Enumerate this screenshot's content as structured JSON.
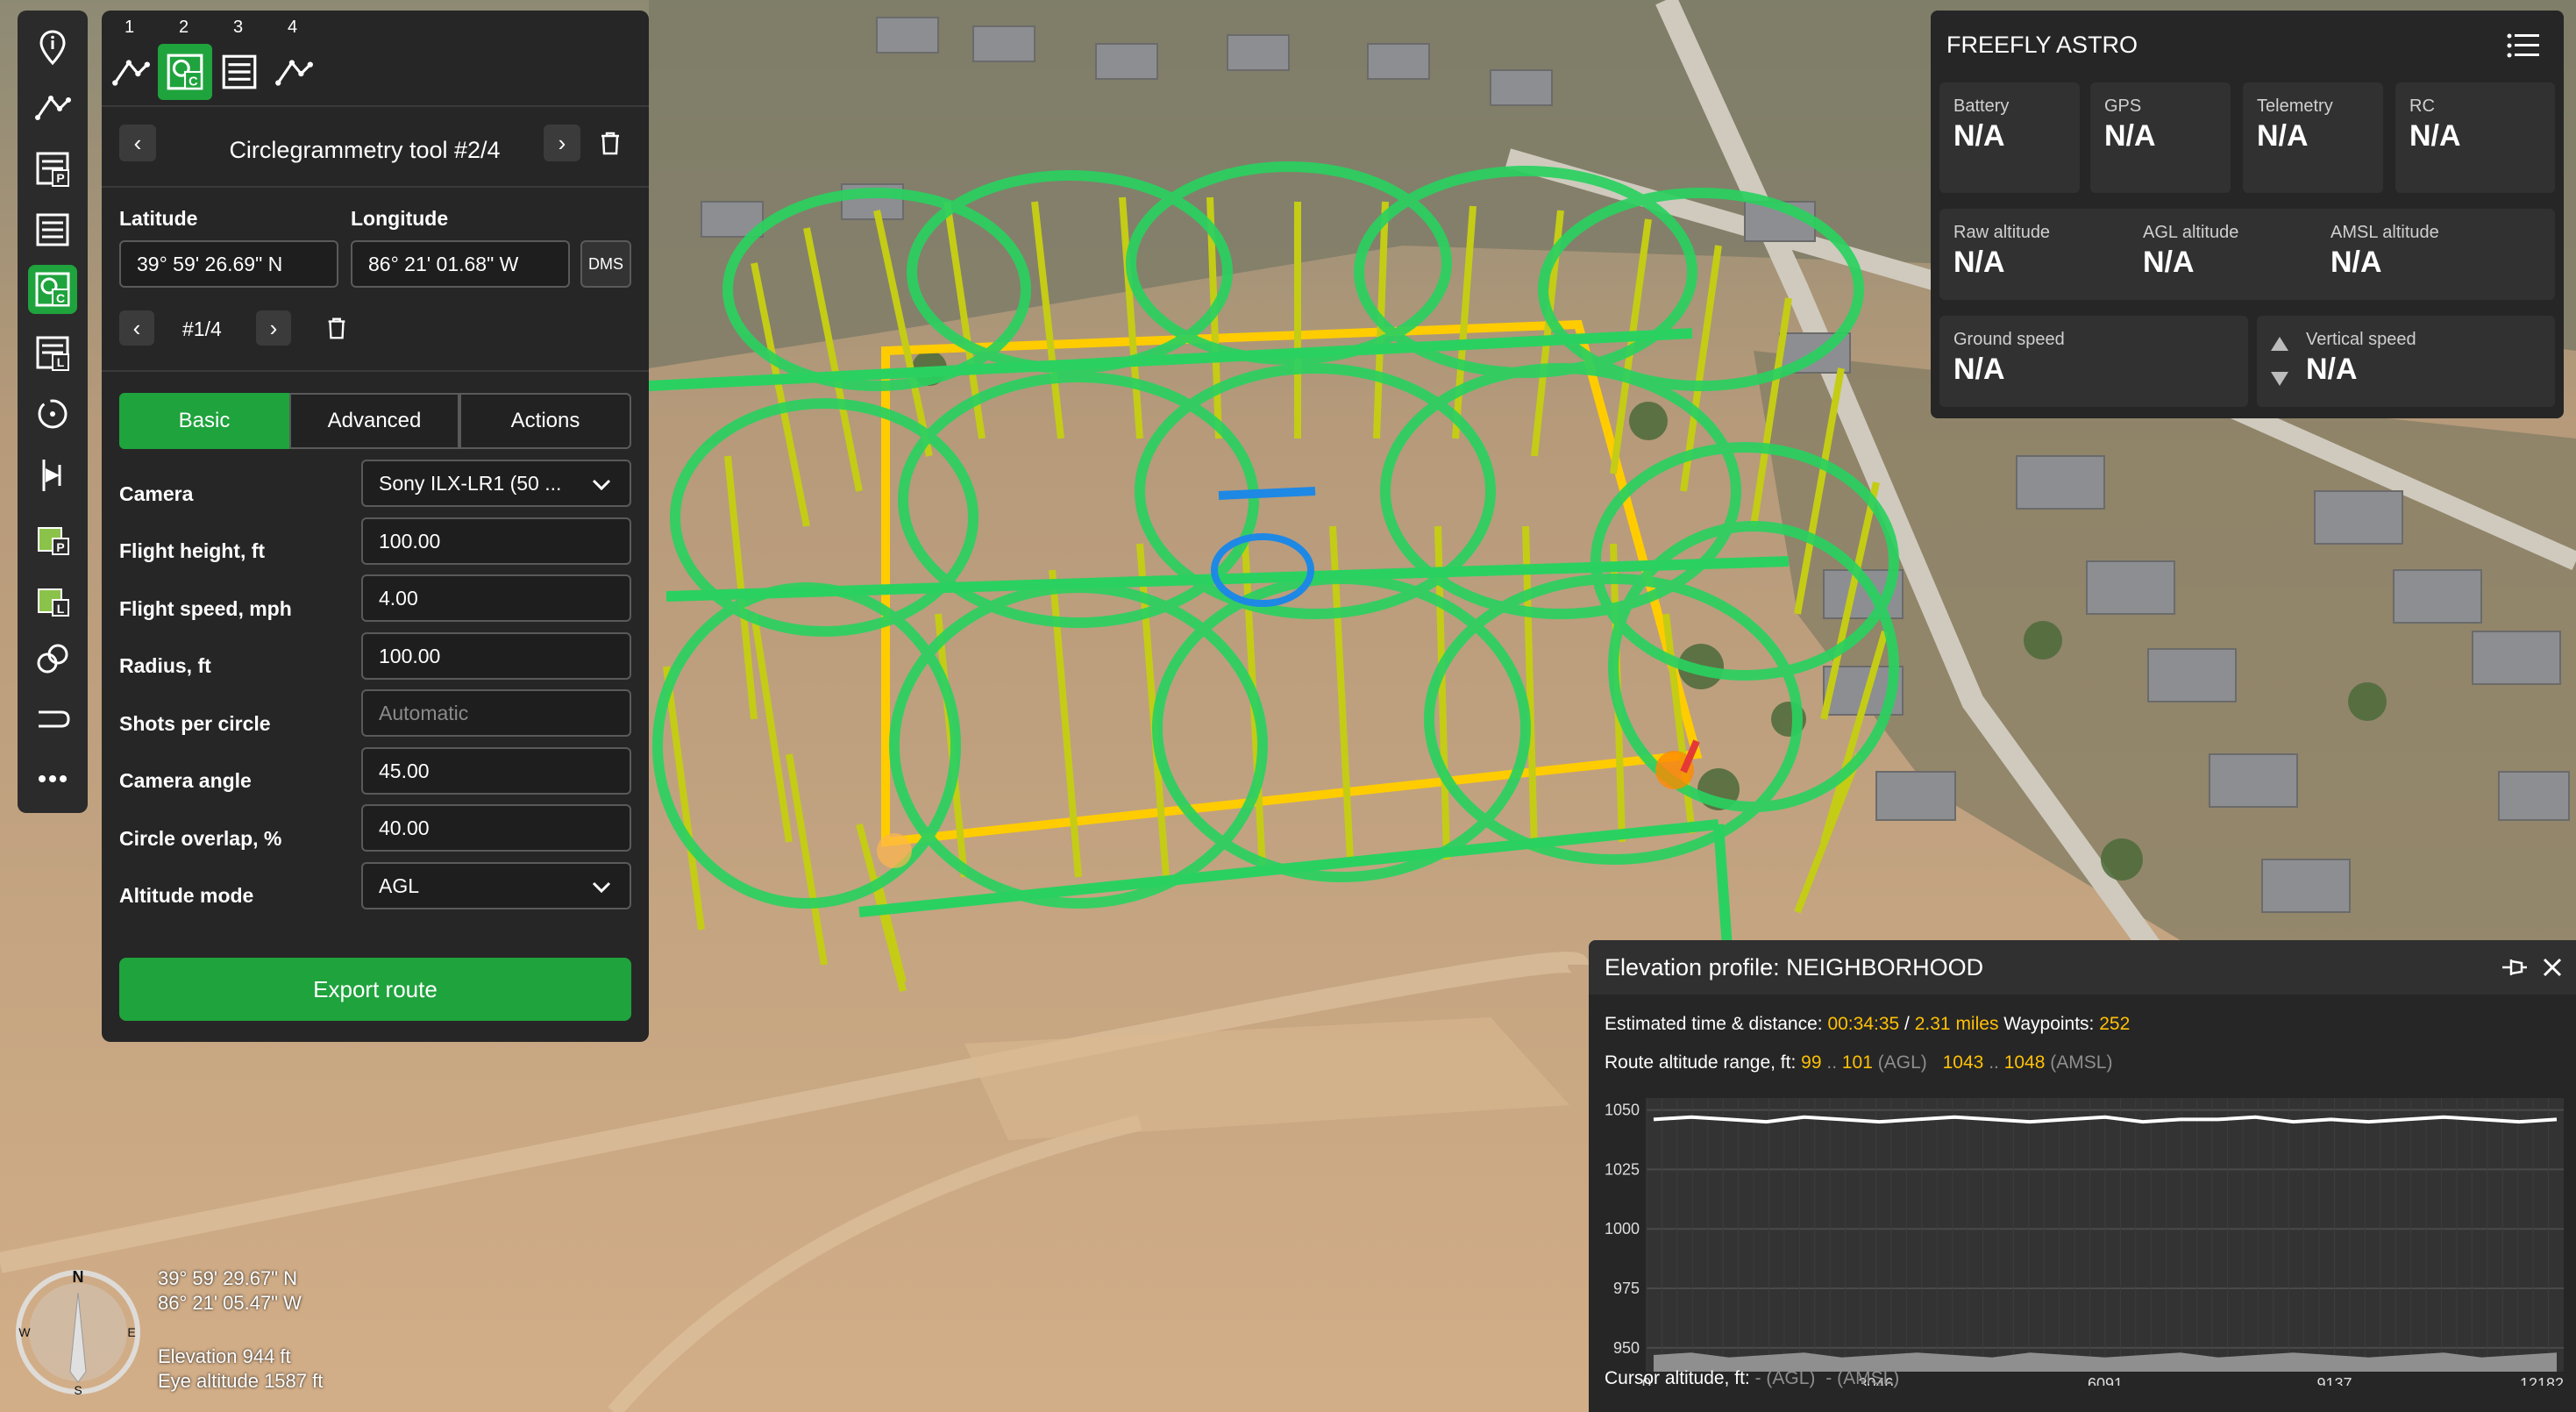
{
  "panel": {
    "tab_numbers": [
      "1",
      "2",
      "3",
      "4"
    ],
    "tool_title": "Circlegrammetry tool #2/4",
    "latitude_label": "Latitude",
    "longitude_label": "Longitude",
    "latitude_value": "39° 59' 26.69\" N",
    "longitude_value": "86° 21' 01.68\" W",
    "format_button": "DMS",
    "waypoint_index": "#1/4",
    "tabs": {
      "basic": "Basic",
      "advanced": "Advanced",
      "actions": "Actions"
    },
    "fields": [
      {
        "label": "Camera",
        "value": "Sony ILX-LR1 (50 ...",
        "type": "select"
      },
      {
        "label": "Flight height, ft",
        "value": "100.00",
        "type": "input"
      },
      {
        "label": "Flight speed, mph",
        "value": "4.00",
        "type": "input"
      },
      {
        "label": "Radius, ft",
        "value": "100.00",
        "type": "input"
      },
      {
        "label": "Shots per circle",
        "placeholder": "Automatic",
        "type": "input"
      },
      {
        "label": "Camera angle",
        "value": "45.00",
        "type": "input"
      },
      {
        "label": "Circle overlap, %",
        "value": "40.00",
        "type": "input"
      },
      {
        "label": "Altitude mode",
        "value": "AGL",
        "type": "select"
      }
    ],
    "export_label": "Export route"
  },
  "telemetry": {
    "title": "FREEFLY ASTRO",
    "row1": [
      {
        "label": "Battery",
        "value": "N/A"
      },
      {
        "label": "GPS",
        "value": "N/A"
      },
      {
        "label": "Telemetry",
        "value": "N/A"
      },
      {
        "label": "RC",
        "value": "N/A"
      }
    ],
    "row2": [
      {
        "label": "Raw altitude",
        "value": "N/A"
      },
      {
        "label": "AGL altitude",
        "value": "N/A"
      },
      {
        "label": "AMSL altitude",
        "value": "N/A"
      }
    ],
    "ground_speed": {
      "label": "Ground speed",
      "value": "N/A"
    },
    "vertical_speed": {
      "label": "Vertical speed",
      "value": "N/A"
    }
  },
  "elevation": {
    "title": "Elevation profile: NEIGHBORHOOD",
    "time_label": "Estimated time & distance:",
    "time_value": "00:34:35",
    "sep": "/",
    "distance_value": "2.31 miles",
    "waypoints_label": "Waypoints:",
    "waypoints_value": "252",
    "range_label": "Route altitude range, ft:",
    "agl_min": "99",
    "range_dots": "..",
    "agl_max": "101",
    "agl_tag": "(AGL)",
    "amsl_min": "1043",
    "amsl_max": "1048",
    "amsl_tag": "(AMSL)",
    "cursor_label": "Cursor altitude, ft:",
    "cursor_agl": "-",
    "cursor_amsl": "-"
  },
  "chart_data": {
    "type": "line",
    "yticks": [
      "1050",
      "1025",
      "1000",
      "975",
      "950"
    ],
    "xticks": [
      "0",
      "3046",
      "6091",
      "9137",
      "12182"
    ],
    "ylim": [
      940,
      1055
    ],
    "xlim": [
      0,
      12182
    ],
    "series": [
      {
        "values": [
          1046,
          1047,
          1046,
          1045,
          1047,
          1046,
          1045,
          1046,
          1047,
          1046,
          1045,
          1046,
          1047,
          1045,
          1046,
          1046,
          1047,
          1045,
          1046,
          1045,
          1046,
          1047,
          1046,
          1045,
          1046
        ]
      },
      {
        "values": [
          947,
          948,
          946,
          947,
          948,
          946,
          947,
          948,
          947,
          946,
          948,
          947,
          946,
          947,
          948,
          946,
          947,
          948,
          947,
          946,
          947,
          948,
          946,
          947,
          948
        ]
      }
    ]
  },
  "map": {
    "compass_n": "N",
    "compass_s": "S",
    "compass_e": "E",
    "compass_w": "W",
    "cursor_lat": "39° 59' 29.67\" N",
    "cursor_lon": "86° 21' 05.47\" W",
    "elevation": "Elevation 944 ft",
    "eye_altitude": "Eye altitude 1587 ft"
  },
  "colors": {
    "accent": "#1fa33d",
    "highlight": "#ffc107",
    "panel": "#262626"
  }
}
